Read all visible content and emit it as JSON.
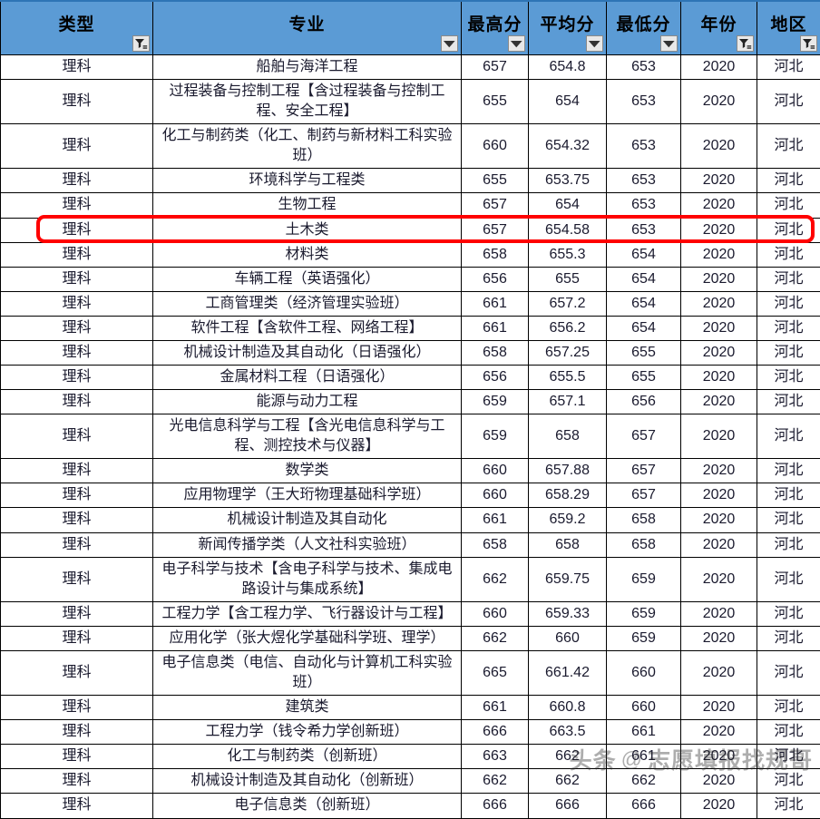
{
  "table": {
    "columns": [
      {
        "key": "type",
        "label": "类型",
        "filter_icon": "funnel-filter-icon",
        "filtered": true
      },
      {
        "key": "major",
        "label": "专业",
        "filter_icon": "chevron-down-icon",
        "filtered": false
      },
      {
        "key": "max",
        "label": "最高分",
        "filter_icon": "chevron-down-icon",
        "filtered": false
      },
      {
        "key": "avg",
        "label": "平均分",
        "filter_icon": "chevron-down-icon",
        "filtered": false
      },
      {
        "key": "min",
        "label": "最低分",
        "filter_icon": "chevron-down-icon",
        "filtered": false
      },
      {
        "key": "year",
        "label": "年份",
        "filter_icon": "funnel-filter-icon",
        "filtered": true
      },
      {
        "key": "region",
        "label": "地区",
        "filter_icon": "funnel-filter-icon",
        "filtered": true
      }
    ],
    "rows": [
      {
        "type": "理科",
        "major": "船舶与海洋工程",
        "max": "657",
        "avg": "654.8",
        "min": "653",
        "year": "2020",
        "region": "河北",
        "highlighted": false
      },
      {
        "type": "理科",
        "major": "过程装备与控制工程【含过程装备与控制工程、安全工程】",
        "max": "655",
        "avg": "654",
        "min": "653",
        "year": "2020",
        "region": "河北",
        "highlighted": false
      },
      {
        "type": "理科",
        "major": "化工与制药类（化工、制药与新材料工科实验班）",
        "max": "660",
        "avg": "654.32",
        "min": "653",
        "year": "2020",
        "region": "河北",
        "highlighted": false
      },
      {
        "type": "理科",
        "major": "环境科学与工程类",
        "max": "655",
        "avg": "653.75",
        "min": "653",
        "year": "2020",
        "region": "河北",
        "highlighted": false
      },
      {
        "type": "理科",
        "major": "生物工程",
        "max": "657",
        "avg": "654",
        "min": "653",
        "year": "2020",
        "region": "河北",
        "highlighted": false
      },
      {
        "type": "理科",
        "major": "土木类",
        "max": "657",
        "avg": "654.58",
        "min": "653",
        "year": "2020",
        "region": "河北",
        "highlighted": true
      },
      {
        "type": "理科",
        "major": "材料类",
        "max": "658",
        "avg": "655.3",
        "min": "654",
        "year": "2020",
        "region": "河北",
        "highlighted": false
      },
      {
        "type": "理科",
        "major": "车辆工程（英语强化）",
        "max": "656",
        "avg": "655",
        "min": "654",
        "year": "2020",
        "region": "河北",
        "highlighted": false
      },
      {
        "type": "理科",
        "major": "工商管理类（经济管理实验班）",
        "max": "661",
        "avg": "657.2",
        "min": "654",
        "year": "2020",
        "region": "河北",
        "highlighted": false
      },
      {
        "type": "理科",
        "major": "软件工程【含软件工程、网络工程】",
        "max": "661",
        "avg": "656.2",
        "min": "654",
        "year": "2020",
        "region": "河北",
        "highlighted": false
      },
      {
        "type": "理科",
        "major": "机械设计制造及其自动化（日语强化）",
        "max": "658",
        "avg": "657.25",
        "min": "655",
        "year": "2020",
        "region": "河北",
        "highlighted": false
      },
      {
        "type": "理科",
        "major": "金属材料工程（日语强化）",
        "max": "656",
        "avg": "655.5",
        "min": "655",
        "year": "2020",
        "region": "河北",
        "highlighted": false
      },
      {
        "type": "理科",
        "major": "能源与动力工程",
        "max": "659",
        "avg": "657.1",
        "min": "656",
        "year": "2020",
        "region": "河北",
        "highlighted": false
      },
      {
        "type": "理科",
        "major": "光电信息科学与工程【含光电信息科学与工程、测控技术与仪器】",
        "max": "659",
        "avg": "658",
        "min": "657",
        "year": "2020",
        "region": "河北",
        "highlighted": false
      },
      {
        "type": "理科",
        "major": "数学类",
        "max": "660",
        "avg": "657.88",
        "min": "657",
        "year": "2020",
        "region": "河北",
        "highlighted": false
      },
      {
        "type": "理科",
        "major": "应用物理学（王大珩物理基础科学班）",
        "max": "660",
        "avg": "658.29",
        "min": "657",
        "year": "2020",
        "region": "河北",
        "highlighted": false
      },
      {
        "type": "理科",
        "major": "机械设计制造及其自动化",
        "max": "661",
        "avg": "659.2",
        "min": "658",
        "year": "2020",
        "region": "河北",
        "highlighted": false
      },
      {
        "type": "理科",
        "major": "新闻传播学类（人文社科实验班）",
        "max": "658",
        "avg": "658",
        "min": "658",
        "year": "2020",
        "region": "河北",
        "highlighted": false
      },
      {
        "type": "理科",
        "major": "电子科学与技术【含电子科学与技术、集成电路设计与集成系统】",
        "max": "662",
        "avg": "659.75",
        "min": "659",
        "year": "2020",
        "region": "河北",
        "highlighted": false
      },
      {
        "type": "理科",
        "major": "工程力学【含工程力学、飞行器设计与工程】",
        "max": "660",
        "avg": "659.33",
        "min": "659",
        "year": "2020",
        "region": "河北",
        "highlighted": false
      },
      {
        "type": "理科",
        "major": "应用化学（张大煜化学基础科学班、理学）",
        "max": "662",
        "avg": "660",
        "min": "659",
        "year": "2020",
        "region": "河北",
        "highlighted": false
      },
      {
        "type": "理科",
        "major": "电子信息类（电信、自动化与计算机工科实验班）",
        "max": "665",
        "avg": "661.42",
        "min": "660",
        "year": "2020",
        "region": "河北",
        "highlighted": false
      },
      {
        "type": "理科",
        "major": "建筑类",
        "max": "661",
        "avg": "660.8",
        "min": "660",
        "year": "2020",
        "region": "河北",
        "highlighted": false
      },
      {
        "type": "理科",
        "major": "工程力学（钱令希力学创新班）",
        "max": "666",
        "avg": "663.5",
        "min": "661",
        "year": "2020",
        "region": "河北",
        "highlighted": false
      },
      {
        "type": "理科",
        "major": "化工与制药类（创新班）",
        "max": "663",
        "avg": "662",
        "min": "661",
        "year": "2020",
        "region": "河北",
        "highlighted": false
      },
      {
        "type": "理科",
        "major": "机械设计制造及其自动化（创新班）",
        "max": "662",
        "avg": "662",
        "min": "662",
        "year": "2020",
        "region": "河北",
        "highlighted": false
      },
      {
        "type": "理科",
        "major": "电子信息类（创新班）",
        "max": "666",
        "avg": "666",
        "min": "666",
        "year": "2020",
        "region": "河北",
        "highlighted": false
      }
    ]
  },
  "watermark": {
    "brand": "头条",
    "at": "@",
    "handle": "志愿填报找规哥"
  },
  "colors": {
    "header_bg": "#5B9BD5",
    "highlight_border": "#FF0000",
    "grid_line": "#000000",
    "cell_text": "#1A1A2E"
  }
}
